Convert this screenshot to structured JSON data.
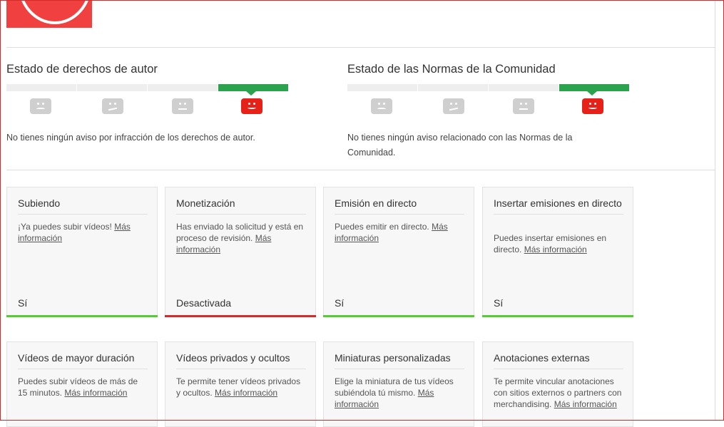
{
  "logo": {
    "name": "channel-logo",
    "text": "————"
  },
  "copyright": {
    "title": "Estado de derechos de autor",
    "message": "No tienes ningún aviso por infracción de los derechos de autor.",
    "level_active": 4,
    "levels": 4
  },
  "community": {
    "title": "Estado de las Normas de la Comunidad",
    "message": "No tienes ningún aviso relacionado con las Normas de la Comunidad.",
    "level_active": 4,
    "levels": 4
  },
  "colors": {
    "good": "#2ba24c",
    "ok_bar": "#55cc33",
    "bad_bar": "#d12b2b",
    "face_active": "#e62117",
    "face_inactive": "#cfcfcf"
  },
  "features": [
    {
      "title": "Subiendo",
      "desc": "¡Ya puedes subir vídeos!",
      "link": "Más información",
      "state": "Sí",
      "status": "ok"
    },
    {
      "title": "Monetización",
      "desc": "Has enviado la solicitud y está en proceso de revisión.",
      "link": "Más información",
      "state": "Desactivada",
      "status": "bad"
    },
    {
      "title": "Emisión en directo",
      "desc": "Puedes emitir en directo.",
      "link": "Más información",
      "state": "Sí",
      "status": "ok"
    },
    {
      "title": "Insertar emisiones en directo",
      "desc": "Puedes insertar emisiones en directo.",
      "link": "Más información",
      "state": "Sí",
      "status": "ok"
    },
    {
      "title": "Vídeos de mayor duración",
      "desc": "Puedes subir vídeos de más de 15 minutos.",
      "link": "Más información",
      "state": "",
      "status": ""
    },
    {
      "title": "Vídeos privados y ocultos",
      "desc": "Te permite tener vídeos privados y ocultos.",
      "link": "Más información",
      "state": "",
      "status": ""
    },
    {
      "title": "Miniaturas personalizadas",
      "desc": "Elige la miniatura de tus vídeos subiéndola tú mismo.",
      "link": "Más información",
      "state": "",
      "status": ""
    },
    {
      "title": "Anotaciones externas",
      "desc": "Te permite vincular anotaciones con sitios externos o partners con merchandising.",
      "link": "Más información",
      "state": "",
      "status": ""
    }
  ]
}
